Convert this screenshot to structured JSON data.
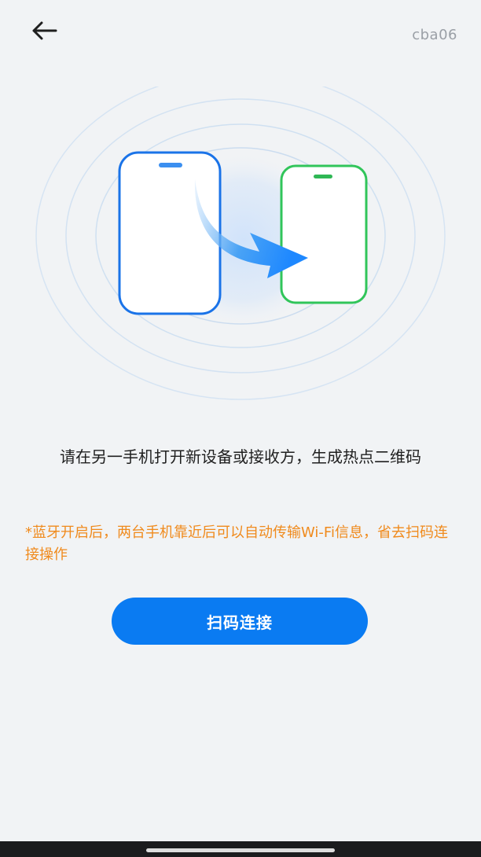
{
  "header": {
    "back_icon": "arrow-left-icon",
    "device_id": "cba06"
  },
  "illustration": {
    "source_phone_icon": "phone-outline-icon",
    "target_phone_icon": "phone-outline-icon",
    "transfer_arrow_icon": "transfer-arrow-icon",
    "colors": {
      "source_phone": "#1a73e8",
      "target_phone": "#31c55a",
      "arrow": "#1e88ff",
      "rings": "#cfe1f5"
    }
  },
  "content": {
    "instruction": "请在另一手机打开新设备或接收方，生成热点二维码",
    "hint": "*蓝牙开启后，两台手机靠近后可以自动传输Wi-Fi信息，省去扫码连接操作"
  },
  "actions": {
    "scan_connect_label": "扫码连接"
  },
  "colors": {
    "primary": "#0a7bf2",
    "hint": "#f08a1c",
    "background": "#f1f3f5"
  }
}
